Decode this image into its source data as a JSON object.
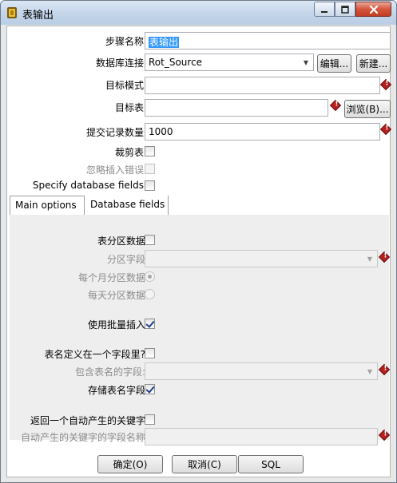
{
  "window": {
    "title": "表输出"
  },
  "form": {
    "step_name_label": "步骤名称",
    "step_name_value": "表输出",
    "connection_label": "数据库连接",
    "connection_value": "Rot_Source",
    "edit_button": "编辑...",
    "new_button": "新建...",
    "target_schema_label": "目标模式",
    "target_schema_value": "",
    "target_table_label": "目标表",
    "target_table_value": "",
    "browse_button": "浏览(B)...",
    "commit_size_label": "提交记录数量",
    "commit_size_value": "1000",
    "truncate_label": "裁剪表",
    "truncate_checked": false,
    "ignore_errors_label": "忽略插入错误",
    "ignore_errors_checked": false,
    "specify_fields_label": "Specify database fields",
    "specify_fields_checked": false
  },
  "tabs": [
    {
      "label": "Main options",
      "active": true
    },
    {
      "label": "Database fields",
      "active": false
    }
  ],
  "main_options": {
    "partition_label": "表分区数据",
    "partition_checked": false,
    "partition_field_label": "分区字段",
    "partition_field_value": "",
    "monthly_label": "每个月分区数据",
    "monthly_selected": true,
    "daily_label": "每天分区数据",
    "daily_selected": false,
    "batch_label": "使用批量插入",
    "batch_checked": true,
    "tablename_in_field_label": "表名定义在一个字段里?",
    "tablename_in_field_checked": false,
    "tablename_field_label": "包含表名的字段:",
    "tablename_field_value": "",
    "store_tablename_label": "存储表名字段",
    "store_tablename_checked": true,
    "return_key_label": "返回一个自动产生的关键字",
    "return_key_checked": false,
    "key_field_label": "自动产生的关键字的字段名称",
    "key_field_value": ""
  },
  "buttons": {
    "ok": "确定(O)",
    "cancel": "取消(C)",
    "sql": "SQL"
  },
  "colors": {
    "required_marker": "#b52020",
    "selection": "#3399ff",
    "close_button": "#c23c24"
  }
}
